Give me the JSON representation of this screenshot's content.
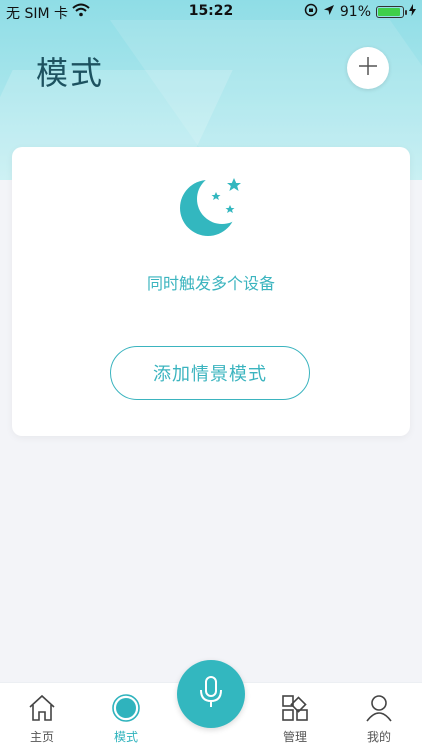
{
  "status_bar": {
    "carrier": "无 SIM 卡",
    "time": "15:22",
    "battery": "91%"
  },
  "header": {
    "title": "模式"
  },
  "card": {
    "description": "同时触发多个设备",
    "add_scene_label": "添加情景模式"
  },
  "tabbar": {
    "tabs": [
      {
        "label": "主页",
        "icon": "home-icon",
        "active": false
      },
      {
        "label": "模式",
        "icon": "mode-icon",
        "active": true
      },
      {
        "label": "管理",
        "icon": "grid-icon",
        "active": false
      },
      {
        "label": "我的",
        "icon": "user-icon",
        "active": false
      }
    ],
    "center_button_icon": "microphone-icon"
  },
  "colors": {
    "accent": "#33b7bf",
    "title": "#1d5260",
    "hero_bg": "#a9e6ec"
  }
}
